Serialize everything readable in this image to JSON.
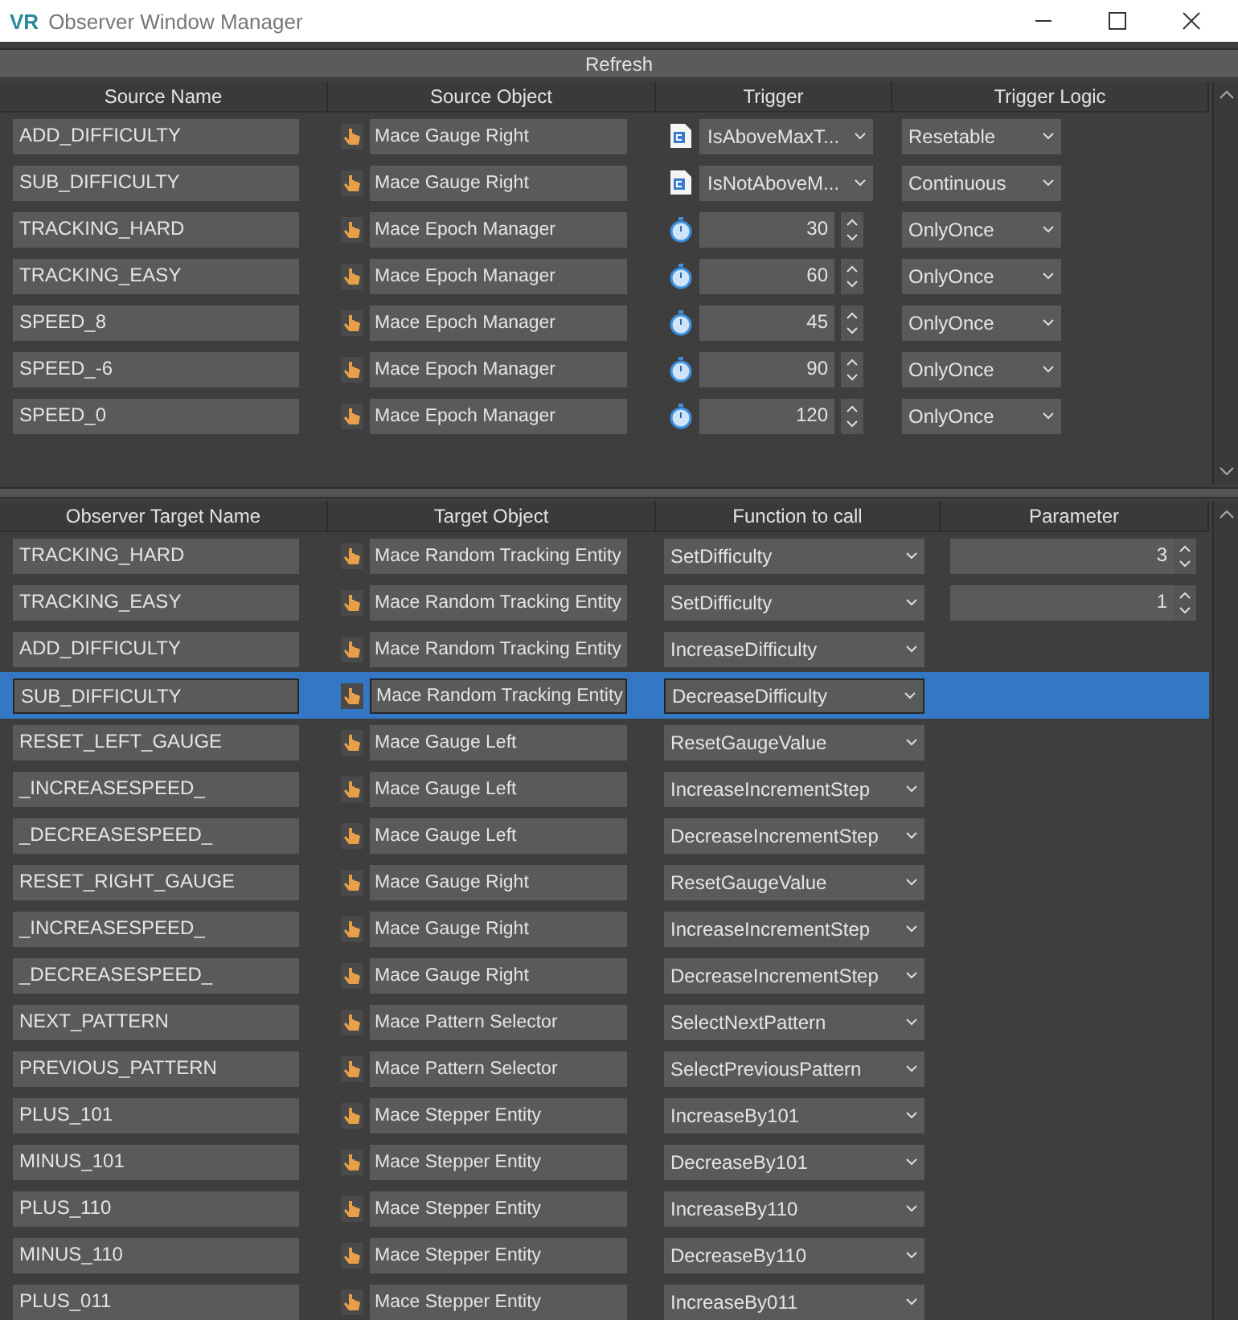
{
  "window": {
    "logo": "VR",
    "title": "Observer Window Manager"
  },
  "refresh_button": "Refresh",
  "sources": {
    "columns": [
      "Source Name",
      "Source Object",
      "Trigger",
      "Trigger Logic"
    ],
    "rows": [
      {
        "name": "ADD_DIFFICULTY",
        "object": "Mace Gauge Right",
        "trigger": {
          "kind": "method",
          "value": "IsAboveMaxT..."
        },
        "logic": "Resetable"
      },
      {
        "name": "SUB_DIFFICULTY",
        "object": "Mace Gauge Right",
        "trigger": {
          "kind": "method",
          "value": "IsNotAboveM..."
        },
        "logic": "Continuous"
      },
      {
        "name": "TRACKING_HARD",
        "object": "Mace Epoch Manager",
        "trigger": {
          "kind": "timer",
          "value": "30"
        },
        "logic": "OnlyOnce"
      },
      {
        "name": "TRACKING_EASY",
        "object": "Mace Epoch Manager",
        "trigger": {
          "kind": "timer",
          "value": "60"
        },
        "logic": "OnlyOnce"
      },
      {
        "name": "SPEED_8",
        "object": "Mace Epoch Manager",
        "trigger": {
          "kind": "timer",
          "value": "45"
        },
        "logic": "OnlyOnce"
      },
      {
        "name": "SPEED_-6",
        "object": "Mace Epoch Manager",
        "trigger": {
          "kind": "timer",
          "value": "90"
        },
        "logic": "OnlyOnce"
      },
      {
        "name": "SPEED_0",
        "object": "Mace Epoch Manager",
        "trigger": {
          "kind": "timer",
          "value": "120"
        },
        "logic": "OnlyOnce"
      }
    ]
  },
  "targets": {
    "columns": [
      "Observer Target Name",
      "Target Object",
      "Function to call",
      "Parameter"
    ],
    "rows": [
      {
        "name": "TRACKING_HARD",
        "object": "Mace Random Tracking Entity",
        "function": "SetDifficulty",
        "parameter": "3",
        "selected": false
      },
      {
        "name": "TRACKING_EASY",
        "object": "Mace Random Tracking Entity",
        "function": "SetDifficulty",
        "parameter": "1",
        "selected": false
      },
      {
        "name": "ADD_DIFFICULTY",
        "object": "Mace Random Tracking Entity",
        "function": "IncreaseDifficulty",
        "selected": false
      },
      {
        "name": "SUB_DIFFICULTY",
        "object": "Mace Random Tracking Entity",
        "function": "DecreaseDifficulty",
        "selected": true
      },
      {
        "name": "RESET_LEFT_GAUGE",
        "object": "Mace Gauge Left",
        "function": "ResetGaugeValue",
        "selected": false
      },
      {
        "name": "_INCREASESPEED_",
        "object": "Mace Gauge Left",
        "function": "IncreaseIncrementStep",
        "selected": false
      },
      {
        "name": "_DECREASESPEED_",
        "object": "Mace Gauge Left",
        "function": "DecreaseIncrementStep",
        "selected": false
      },
      {
        "name": "RESET_RIGHT_GAUGE",
        "object": "Mace Gauge Right",
        "function": "ResetGaugeValue",
        "selected": false
      },
      {
        "name": "_INCREASESPEED_",
        "object": "Mace Gauge Right",
        "function": "IncreaseIncrementStep",
        "selected": false
      },
      {
        "name": "_DECREASESPEED_",
        "object": "Mace Gauge Right",
        "function": "DecreaseIncrementStep",
        "selected": false
      },
      {
        "name": "NEXT_PATTERN",
        "object": "Mace Pattern Selector",
        "function": "SelectNextPattern",
        "selected": false
      },
      {
        "name": "PREVIOUS_PATTERN",
        "object": "Mace Pattern Selector",
        "function": "SelectPreviousPattern",
        "selected": false
      },
      {
        "name": "PLUS_101",
        "object": "Mace Stepper Entity",
        "function": "IncreaseBy101",
        "selected": false
      },
      {
        "name": "MINUS_101",
        "object": "Mace Stepper Entity",
        "function": "DecreaseBy101",
        "selected": false
      },
      {
        "name": "PLUS_110",
        "object": "Mace Stepper Entity",
        "function": "IncreaseBy110",
        "selected": false
      },
      {
        "name": "MINUS_110",
        "object": "Mace Stepper Entity",
        "function": "DecreaseBy110",
        "selected": false
      },
      {
        "name": "PLUS_011",
        "object": "Mace Stepper Entity",
        "function": "IncreaseBy011",
        "selected": false
      }
    ]
  }
}
